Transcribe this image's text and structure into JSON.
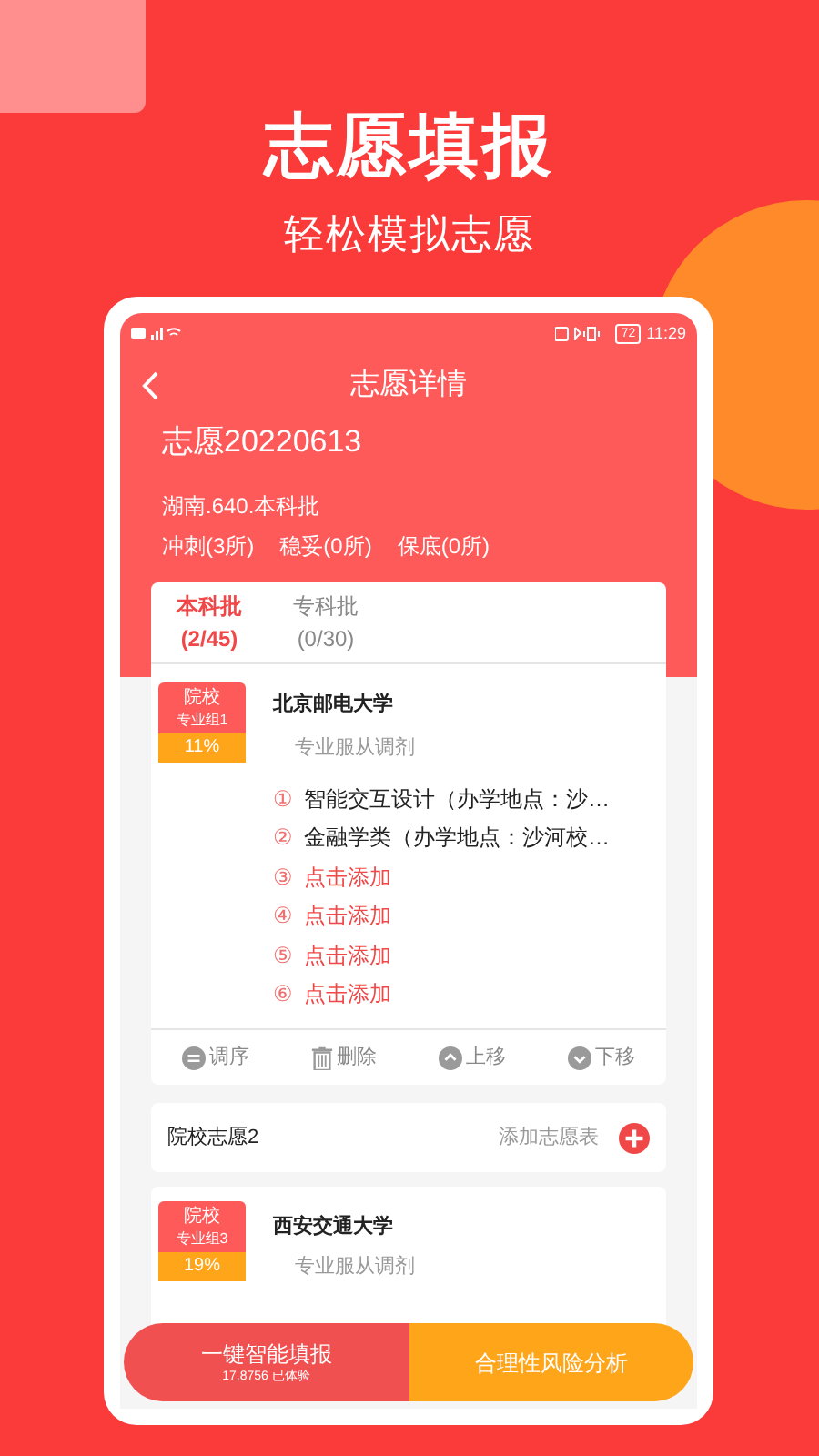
{
  "hero": {
    "title": "志愿填报",
    "subtitle": "轻松模拟志愿"
  },
  "status_bar": {
    "time": "11:29",
    "battery": "72"
  },
  "header": {
    "title": "志愿详情",
    "plan_name": "志愿20220613",
    "batch": "湖南.640.本科批",
    "counts": [
      "冲刺(3所)",
      "稳妥(0所)",
      "保底(0所)"
    ]
  },
  "tabs": [
    {
      "label": "本科批",
      "count": "(2/45)",
      "selected": true
    },
    {
      "label": "专科批",
      "count": "(0/30)",
      "selected": false
    }
  ],
  "group": {
    "badge_top": "院校",
    "badge_sub": "专业组1",
    "percent": "11%",
    "school": "北京邮电大学",
    "adjust": "专业服从调剂",
    "majors": [
      {
        "index": "①",
        "text": "智能交互设计（办学地点：沙…",
        "kind": "filled"
      },
      {
        "index": "②",
        "text": "金融学类（办学地点：沙河校…",
        "kind": "filled"
      },
      {
        "index": "③",
        "text": "点击添加",
        "kind": "empty"
      },
      {
        "index": "④",
        "text": "点击添加",
        "kind": "empty"
      },
      {
        "index": "⑤",
        "text": "点击添加",
        "kind": "empty"
      },
      {
        "index": "⑥",
        "text": "点击添加",
        "kind": "empty"
      }
    ]
  },
  "actions": [
    {
      "label": "调序",
      "kind": "reorder"
    },
    {
      "label": "删除",
      "kind": "delete"
    },
    {
      "label": "上移",
      "kind": "up"
    },
    {
      "label": "下移",
      "kind": "down"
    }
  ],
  "section2": {
    "title": "院校志愿2",
    "action": "添加志愿表"
  },
  "group2": {
    "badge_top": "院校",
    "badge_sub": "专业组3",
    "percent": "19%",
    "school": "西安交通大学",
    "adjust": "专业服从调剂"
  },
  "bottom": {
    "smart_label": "一键智能填报",
    "smart_sub": "17,8756 已体验",
    "analysis_label": "合理性风险分析"
  }
}
